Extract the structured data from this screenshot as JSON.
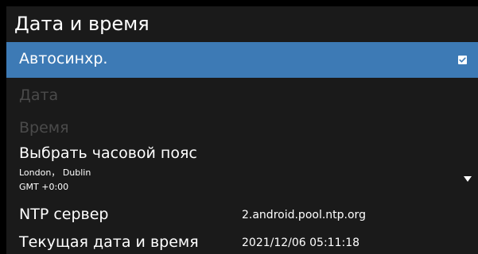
{
  "header": {
    "title": "Дата и время"
  },
  "settings": {
    "auto_sync": {
      "label": "Автосинхр.",
      "checked": true
    },
    "date": {
      "label": "Дата",
      "enabled": false
    },
    "time": {
      "label": "Время",
      "enabled": false
    },
    "timezone": {
      "label": "Выбрать часовой пояс",
      "city": "London， Dublin",
      "offset": "GMT +0:00",
      "icon": "chevron-down-icon"
    },
    "ntp_server": {
      "label": "NTP сервер",
      "value": "2.android.pool.ntp.org"
    },
    "current_datetime": {
      "label": "Текущая дата и время",
      "value": "2021/12/06 05:11:18"
    }
  },
  "colors": {
    "background": "#000000",
    "panel": "#1a1a1a",
    "highlight": "#3d7ab5",
    "disabled_text": "#4a4a4a",
    "text": "#ffffff"
  }
}
